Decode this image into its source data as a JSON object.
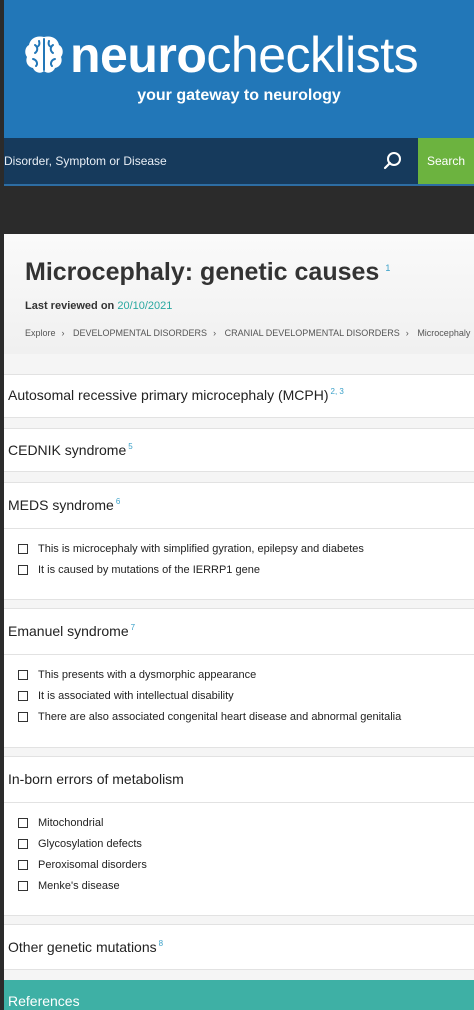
{
  "header": {
    "logo_bold": "neuro",
    "logo_light": "checklists",
    "tagline": "your gateway to neurology"
  },
  "search": {
    "placeholder": "Disorder, Symptom or Disease",
    "button_label": "Search"
  },
  "article": {
    "title": "Microcephaly: genetic causes",
    "title_ref": "1",
    "reviewed_label": "Last reviewed on",
    "reviewed_date": "20/10/2021",
    "breadcrumb": [
      "Explore",
      "DEVELOPMENTAL DISORDERS",
      "CRANIAL DEVELOPMENTAL DISORDERS",
      "Microcephaly"
    ]
  },
  "sections": [
    {
      "title": "Autosomal recessive primary microcephaly (MCPH)",
      "refs": "2, 3",
      "items": []
    },
    {
      "title": "CEDNIK syndrome",
      "refs": "5",
      "items": []
    },
    {
      "title": "MEDS syndrome",
      "refs": "6",
      "items": [
        "This is microcephaly with simplified gyration, epilepsy and diabetes",
        "It is caused by mutations of the IERRP1 gene"
      ]
    },
    {
      "title": "Emanuel syndrome",
      "refs": "7",
      "items": [
        "This presents with a dysmorphic appearance",
        "It is associated with intellectual disability",
        "There are also associated congenital heart disease and abnormal genitalia"
      ]
    },
    {
      "title": "In-born errors of metabolism",
      "refs": "",
      "items": [
        "Mitochondrial",
        "Glycosylation defects",
        "Peroxisomal disorders",
        "Menke's disease"
      ]
    },
    {
      "title": "Other genetic mutations",
      "refs": "8",
      "items": []
    }
  ],
  "references_label": "References",
  "colors": {
    "header": "#2277b8",
    "search_button": "#6cb33f",
    "accent": "#3eb0a5"
  }
}
